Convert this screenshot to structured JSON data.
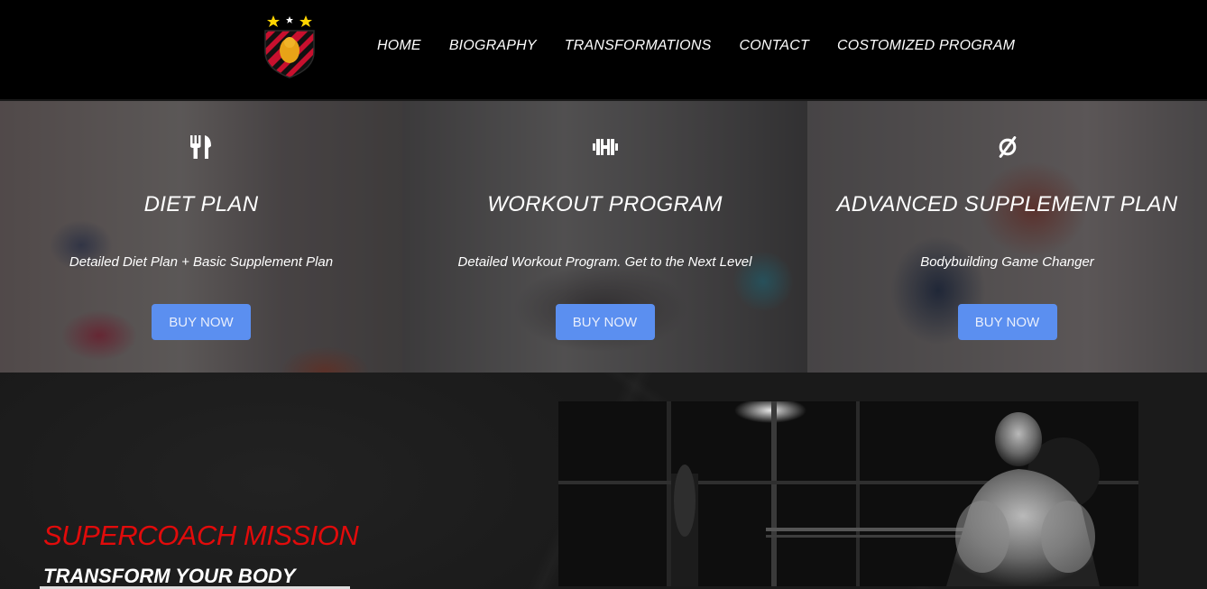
{
  "header": {
    "logo_name": "sport-club-crest",
    "nav": [
      {
        "label": "HOME"
      },
      {
        "label": "BIOGRAPHY"
      },
      {
        "label": "TRANSFORMATIONS"
      },
      {
        "label": "CONTACT"
      },
      {
        "label": "COSTOMIZED PROGRAM"
      }
    ]
  },
  "cards": [
    {
      "icon": "fork-knife-icon",
      "title": "DIET PLAN",
      "description": "Detailed Diet Plan + Basic Supplement Plan",
      "button": "BUY NOW"
    },
    {
      "icon": "dumbbell-icon",
      "title": "WORKOUT PROGRAM",
      "description": "Detailed Workout Program. Get to the Next Level",
      "button": "BUY NOW"
    },
    {
      "icon": "supplement-icon",
      "title": "ADVANCED SUPPLEMENT PLAN",
      "description": "Bodybuilding Game Changer",
      "button": "BUY NOW"
    }
  ],
  "mission": {
    "title": "SUPERCOACH MISSION",
    "subtitle": "TRANSFORM YOUR BODY"
  },
  "colors": {
    "nav_bg": "#000000",
    "accent_button": "#5b8ff0",
    "mission_title": "#e10b0b",
    "page_bg": "#1c1c1c"
  }
}
